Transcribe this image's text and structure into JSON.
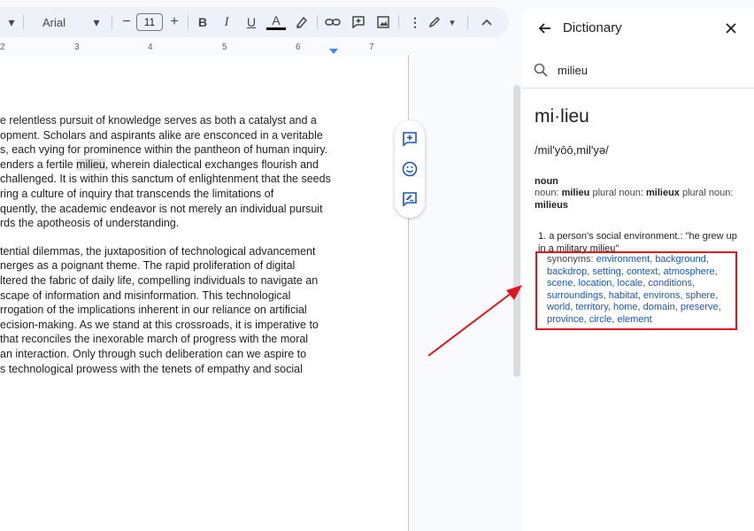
{
  "toolbar": {
    "font": "Arial",
    "font_size": "11",
    "decrease_label": "−",
    "increase_label": "+",
    "bold_label": "B",
    "italic_label": "I",
    "underline_label": "U",
    "text_color_label": "A"
  },
  "ruler": {
    "marks": [
      "2",
      "3",
      "4",
      "5",
      "6",
      "7"
    ]
  },
  "document": {
    "paragraph1": [
      "e relentless pursuit of knowledge serves as both a catalyst and a",
      "opment. Scholars and aspirants alike are ensconced in a veritable",
      "s, each vying for prominence within the pantheon of human inquiry.",
      "enders a fertile ",
      "challenged. It is within this sanctum of enlightenment that the seeds",
      "ring a culture of inquiry that transcends the limitations of",
      "quently, the academic endeavor is not merely an individual pursuit",
      "rds the apotheosis of understanding."
    ],
    "highlight_word": "milieu",
    "line4_rest": ", wherein dialectical exchanges flourish and",
    "paragraph2": [
      "tential dilemmas, the juxtaposition of technological advancement",
      "nerges as a poignant theme. The rapid proliferation of digital",
      "ltered the fabric of daily life, compelling individuals to navigate an",
      "scape of information and misinformation. This technological",
      "rrogation of the implications inherent in our reliance on artificial",
      "ecision-making. As we stand at this crossroads, it is imperative to",
      "that reconciles the inexorable march of progress with the moral",
      "an interaction. Only through such deliberation can we aspire to",
      "s technological prowess with the tenets of empathy and social"
    ]
  },
  "dictionary": {
    "title": "Dictionary",
    "search_value": "milieu",
    "headword": "mi·lieu",
    "pronunciation": "/mil'yōō,mil'yə/",
    "part_of_speech": "noun",
    "forms_prefix": "noun: ",
    "form1": "milieu",
    "forms_mid": " plural noun: ",
    "form2": "milieux",
    "forms_mid2": " plural noun: ",
    "form3": "milieus",
    "definition": "1. a person's social environment.: \"he grew up in a military milieu\"",
    "synonyms_label": "synonyms: ",
    "synonyms": [
      "environment",
      "background",
      "backdrop",
      "setting",
      "context",
      "atmosphere",
      "scene",
      "location",
      "locale",
      "conditions",
      "surroundings",
      "habitat",
      "environs",
      "sphere",
      "world",
      "territory",
      "home",
      "domain",
      "preserve",
      "province",
      "circle",
      "element"
    ]
  },
  "colors": {
    "accent": "#1a56b8",
    "annotation": "#e0141e",
    "toolbar_bg": "#edf2fa"
  }
}
